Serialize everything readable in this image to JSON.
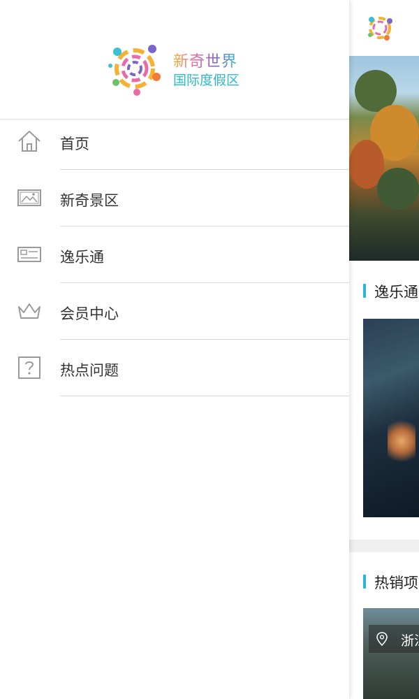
{
  "drawer": {
    "brand": {
      "line1": "新奇世界",
      "line2": "国际度假区"
    },
    "menu": [
      {
        "label": "首页",
        "icon": "home-icon"
      },
      {
        "label": "新奇景区",
        "icon": "image-icon"
      },
      {
        "label": "逸乐通",
        "icon": "card-icon"
      },
      {
        "label": "会员中心",
        "icon": "crown-icon"
      },
      {
        "label": "热点问题",
        "icon": "question-icon"
      }
    ]
  },
  "main": {
    "section1_title": "逸乐通",
    "section2_title": "热销项",
    "location_chip": "浙江"
  },
  "colors": {
    "accent": "#29b6d1",
    "brand_teal": "#2fb9c8"
  }
}
